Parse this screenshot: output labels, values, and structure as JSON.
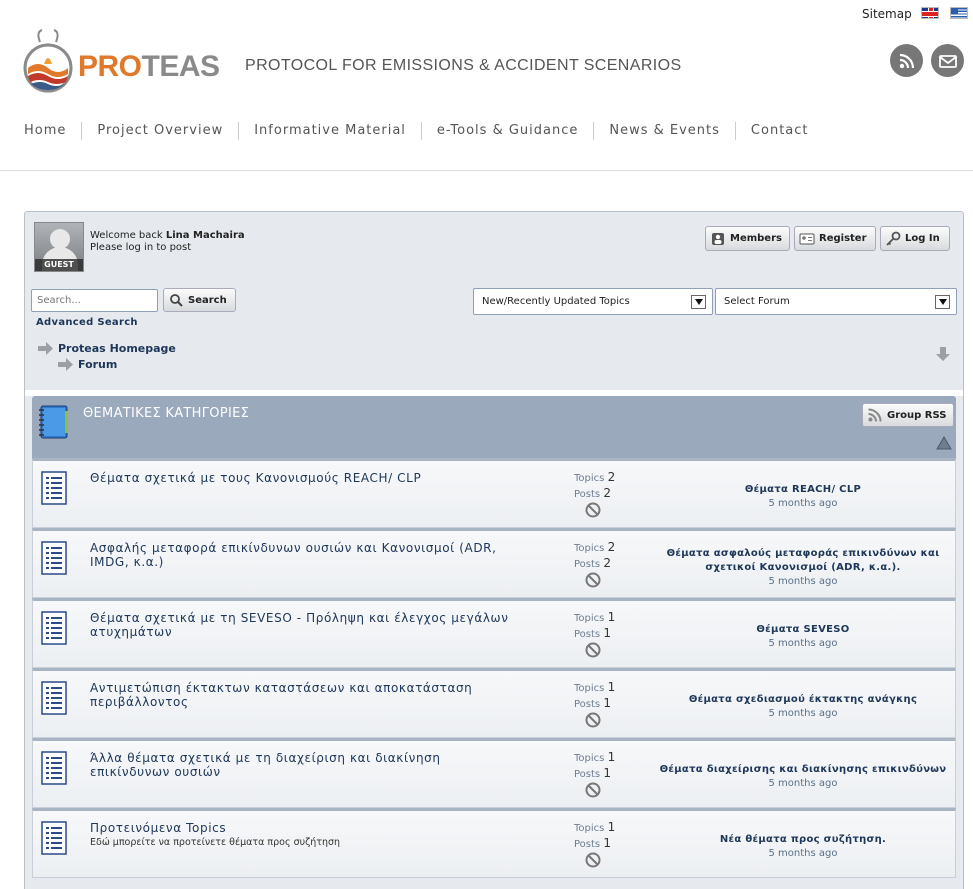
{
  "header": {
    "sitemap_label": "Sitemap",
    "logo_text_pro": "PRO",
    "logo_text_rest": "TEAS",
    "tagline": "PROTOCOL FOR EMISSIONS & ACCIDENT SCENARIOS"
  },
  "nav": {
    "items": [
      "Home",
      "Project Overview",
      "Informative Material",
      "e-Tools & Guidance",
      "News & Events",
      "Contact"
    ]
  },
  "forum": {
    "guest_tag": "GUEST",
    "welcome_prefix": "Welcome back",
    "user_name": "Lina Machaira",
    "login_prompt": "Please log in to post",
    "buttons": {
      "members": "Members",
      "register": "Register",
      "login": "Log In",
      "search": "Search",
      "group_rss": "Group RSS"
    },
    "search_placeholder": "Search...",
    "advanced_search": "Advanced Search",
    "select_topics": "New/Recently Updated Topics",
    "select_forum": "Select Forum",
    "breadcrumb": {
      "home": "Proteas Homepage",
      "forum": "Forum"
    },
    "category_title": "ΘΕΜΑΤΙΚΕΣ ΚΑΤΗΓΟΡΙΕΣ",
    "stats_labels": {
      "topics": "Topics",
      "posts": "Posts"
    },
    "rows": [
      {
        "title": "Θέματα σχετικά με τους Κανονισμούς REACH/ CLP",
        "desc": "",
        "topics": "2",
        "posts": "2",
        "last_title": "Θέματα REACH/ CLP",
        "last_time": "5 months ago"
      },
      {
        "title": "Ασφαλής μεταφορά επικίνδυνων ουσιών και Κανονισμοί (ADR, IMDG, κ.α.)",
        "desc": "",
        "topics": "2",
        "posts": "2",
        "last_title": "Θέματα ασφαλούς μεταφοράς επικινδύνων και σχετικοί Κανονισμοί (ADR, κ.α.).",
        "last_time": "5 months ago"
      },
      {
        "title": "Θέματα σχετικά με τη SEVESO - Πρόληψη και έλεγχος μεγάλων ατυχημάτων",
        "desc": "",
        "topics": "1",
        "posts": "1",
        "last_title": "Θέματα SEVESO",
        "last_time": "5 months ago"
      },
      {
        "title": "Αντιμετώπιση έκτακτων καταστάσεων και αποκατάσταση περιβάλλοντος",
        "desc": "",
        "topics": "1",
        "posts": "1",
        "last_title": "Θέματα σχεδιασμού έκτακτης ανάγκης",
        "last_time": "5 months ago"
      },
      {
        "title": "Άλλα θέματα σχετικά με τη διαχείριση και διακίνηση επικίνδυνων ουσιών",
        "desc": "",
        "topics": "1",
        "posts": "1",
        "last_title": "Θέματα διαχείρισης και διακίνησης επικινδύνων",
        "last_time": "5 months ago"
      },
      {
        "title": "Προτεινόμενα Topics",
        "desc": "Εδώ μπορείτε να προτείνετε θέματα προς συζήτηση",
        "topics": "1",
        "posts": "1",
        "last_title": "Νέα θέματα προς συζήτηση.",
        "last_time": "5 months ago"
      }
    ]
  }
}
